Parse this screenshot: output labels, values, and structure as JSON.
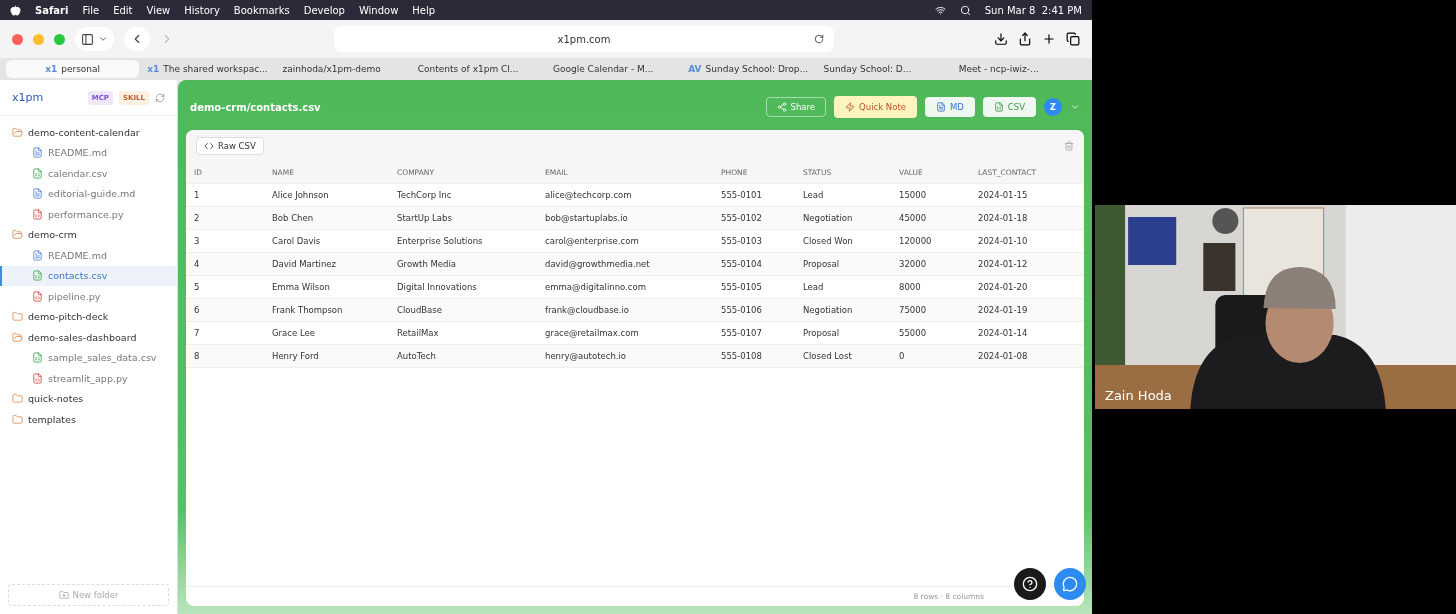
{
  "menu_bar": {
    "app": "Safari",
    "items": [
      "File",
      "Edit",
      "View",
      "History",
      "Bookmarks",
      "Develop",
      "Window",
      "Help"
    ],
    "clock": "Sun Mar 8  2:41 PM"
  },
  "browser": {
    "address": "x1pm.com",
    "tabs": [
      {
        "label": "personal",
        "prefix": "x1",
        "selected": true
      },
      {
        "label": "The shared workspac...",
        "prefix": "x1",
        "selected": false
      },
      {
        "label": "zainhoda/x1pm-demo",
        "selected": false
      },
      {
        "label": "Contents of x1pm Cl...",
        "selected": false
      },
      {
        "label": "Google Calendar - M...",
        "selected": false
      },
      {
        "label": "Sunday School: Drop...",
        "prefix": "AV",
        "selected": false
      },
      {
        "label": "Sunday School: D...",
        "selected": false
      },
      {
        "label": "Meet - ncp-iwiz-...",
        "selected": false
      }
    ]
  },
  "sidebar": {
    "brand": "x1pm",
    "badges": [
      "MCP",
      "SKILL"
    ],
    "new_folder": "New folder",
    "tree": [
      {
        "name": "demo-content-calendar",
        "expanded": true,
        "children": [
          {
            "name": "README.md",
            "kind": "md",
            "selected": false
          },
          {
            "name": "calendar.csv",
            "kind": "csv",
            "selected": false
          },
          {
            "name": "editorial-guide.md",
            "kind": "md",
            "selected": false
          },
          {
            "name": "performance.py",
            "kind": "py",
            "selected": false
          }
        ]
      },
      {
        "name": "demo-crm",
        "expanded": true,
        "children": [
          {
            "name": "README.md",
            "kind": "md",
            "selected": false
          },
          {
            "name": "contacts.csv",
            "kind": "csv",
            "selected": true
          },
          {
            "name": "pipeline.py",
            "kind": "py",
            "selected": false
          }
        ]
      },
      {
        "name": "demo-pitch-deck",
        "expanded": false
      },
      {
        "name": "demo-sales-dashboard",
        "expanded": true,
        "children": [
          {
            "name": "sample_sales_data.csv",
            "kind": "csv",
            "selected": false
          },
          {
            "name": "streamlit_app.py",
            "kind": "py",
            "selected": false
          }
        ]
      },
      {
        "name": "quick-notes",
        "expanded": false
      },
      {
        "name": "templates",
        "expanded": false
      }
    ]
  },
  "header": {
    "path": "demo-crm/contacts.csv",
    "share": "Share",
    "quick_note": "Quick Note",
    "md": "MD",
    "csv": "CSV",
    "avatar": "Z"
  },
  "toolbar": {
    "raw_csv": "Raw CSV"
  },
  "table": {
    "columns": [
      "ID",
      "NAME",
      "COMPANY",
      "EMAIL",
      "PHONE",
      "STATUS",
      "VALUE",
      "LAST_CONTACT"
    ],
    "rows": [
      [
        "1",
        "Alice Johnson",
        "TechCorp Inc",
        "alice@techcorp.com",
        "555-0101",
        "Lead",
        "15000",
        "2024-01-15"
      ],
      [
        "2",
        "Bob Chen",
        "StartUp Labs",
        "bob@startuplabs.io",
        "555-0102",
        "Negotiation",
        "45000",
        "2024-01-18"
      ],
      [
        "3",
        "Carol Davis",
        "Enterprise Solutions",
        "carol@enterprise.com",
        "555-0103",
        "Closed Won",
        "120000",
        "2024-01-10"
      ],
      [
        "4",
        "David Martinez",
        "Growth Media",
        "david@growthmedia.net",
        "555-0104",
        "Proposal",
        "32000",
        "2024-01-12"
      ],
      [
        "5",
        "Emma Wilson",
        "Digital Innovations",
        "emma@digitalinno.com",
        "555-0105",
        "Lead",
        "8000",
        "2024-01-20"
      ],
      [
        "6",
        "Frank Thompson",
        "CloudBase",
        "frank@cloudbase.io",
        "555-0106",
        "Negotiation",
        "75000",
        "2024-01-19"
      ],
      [
        "7",
        "Grace Lee",
        "RetailMax",
        "grace@retailmax.com",
        "555-0107",
        "Proposal",
        "55000",
        "2024-01-14"
      ],
      [
        "8",
        "Henry Ford",
        "AutoTech",
        "henry@autotech.io",
        "555-0108",
        "Closed Lost",
        "0",
        "2024-01-08"
      ]
    ]
  },
  "status_bar": "8 rows · 8 columns",
  "video": {
    "name": "Zain Hoda"
  }
}
